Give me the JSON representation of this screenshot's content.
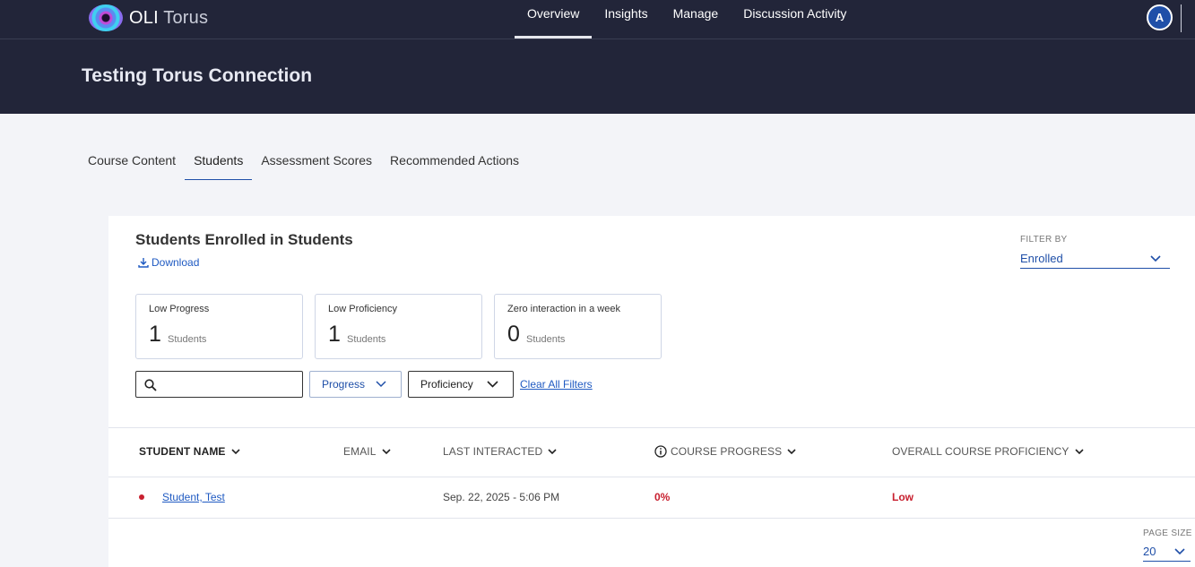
{
  "app": {
    "logo_bold": "OLI",
    "logo_light": "Torus",
    "avatar_initial": "A"
  },
  "nav": {
    "tabs": [
      {
        "label": "Overview",
        "active": true
      },
      {
        "label": "Insights"
      },
      {
        "label": "Manage"
      },
      {
        "label": "Discussion Activity"
      }
    ]
  },
  "header": {
    "title": "Testing Torus Connection"
  },
  "subtabs": [
    {
      "label": "Course Content"
    },
    {
      "label": "Students",
      "active": true
    },
    {
      "label": "Assessment Scores"
    },
    {
      "label": "Recommended Actions"
    }
  ],
  "card": {
    "title": "Students Enrolled in Students",
    "download_label": "Download",
    "filter_by_label": "FILTER BY",
    "filter_value": "Enrolled",
    "stats": [
      {
        "label": "Low Progress",
        "value": "1",
        "unit": "Students"
      },
      {
        "label": "Low Proficiency",
        "value": "1",
        "unit": "Students"
      },
      {
        "label": "Zero interaction in a week",
        "value": "0",
        "unit": "Students"
      }
    ],
    "search": {
      "placeholder": "",
      "value": ""
    },
    "progress_dropdown": "Progress",
    "proficiency_dropdown": "Proficiency",
    "clear_filters": "Clear All Filters"
  },
  "table": {
    "columns": {
      "student_name": "STUDENT NAME",
      "email": "EMAIL",
      "last_interacted": "LAST INTERACTED",
      "course_progress": "COURSE PROGRESS",
      "overall_proficiency": "OVERALL COURSE PROFICIENCY"
    },
    "rows": [
      {
        "student_name": "Student, Test",
        "email": "",
        "last_interacted": "Sep. 22, 2025 - 5:06 PM",
        "course_progress": "0%",
        "overall_proficiency": "Low"
      }
    ]
  },
  "pagination": {
    "page_size_label": "PAGE SIZE",
    "page_size": "20"
  },
  "colors": {
    "nav_bg": "#222539",
    "accent": "#1f4fa8",
    "alert": "#c8202f"
  }
}
